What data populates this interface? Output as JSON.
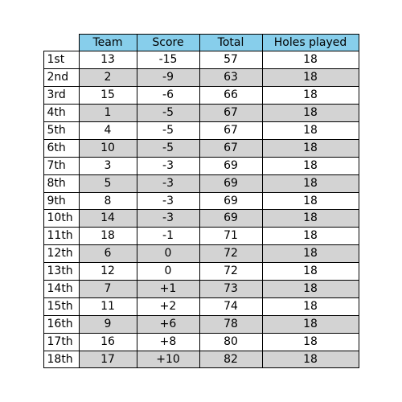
{
  "chart_data": {
    "type": "table",
    "title": "",
    "columns": [
      "Team",
      "Score",
      "Total",
      "Holes played"
    ],
    "rows": [
      {
        "rank": "1st",
        "team": "13",
        "score": "-15",
        "total": "57",
        "holes": "18"
      },
      {
        "rank": "2nd",
        "team": "2",
        "score": "-9",
        "total": "63",
        "holes": "18"
      },
      {
        "rank": "3rd",
        "team": "15",
        "score": "-6",
        "total": "66",
        "holes": "18"
      },
      {
        "rank": "4th",
        "team": "1",
        "score": "-5",
        "total": "67",
        "holes": "18"
      },
      {
        "rank": "5th",
        "team": "4",
        "score": "-5",
        "total": "67",
        "holes": "18"
      },
      {
        "rank": "6th",
        "team": "10",
        "score": "-5",
        "total": "67",
        "holes": "18"
      },
      {
        "rank": "7th",
        "team": "3",
        "score": "-3",
        "total": "69",
        "holes": "18"
      },
      {
        "rank": "8th",
        "team": "5",
        "score": "-3",
        "total": "69",
        "holes": "18"
      },
      {
        "rank": "9th",
        "team": "8",
        "score": "-3",
        "total": "69",
        "holes": "18"
      },
      {
        "rank": "10th",
        "team": "14",
        "score": "-3",
        "total": "69",
        "holes": "18"
      },
      {
        "rank": "11th",
        "team": "18",
        "score": "-1",
        "total": "71",
        "holes": "18"
      },
      {
        "rank": "12th",
        "team": "6",
        "score": "0",
        "total": "72",
        "holes": "18"
      },
      {
        "rank": "13th",
        "team": "12",
        "score": "0",
        "total": "72",
        "holes": "18"
      },
      {
        "rank": "14th",
        "team": "7",
        "score": "+1",
        "total": "73",
        "holes": "18"
      },
      {
        "rank": "15th",
        "team": "11",
        "score": "+2",
        "total": "74",
        "holes": "18"
      },
      {
        "rank": "16th",
        "team": "9",
        "score": "+6",
        "total": "78",
        "holes": "18"
      },
      {
        "rank": "17th",
        "team": "16",
        "score": "+8",
        "total": "80",
        "holes": "18"
      },
      {
        "rank": "18th",
        "team": "17",
        "score": "+10",
        "total": "82",
        "holes": "18"
      }
    ]
  }
}
